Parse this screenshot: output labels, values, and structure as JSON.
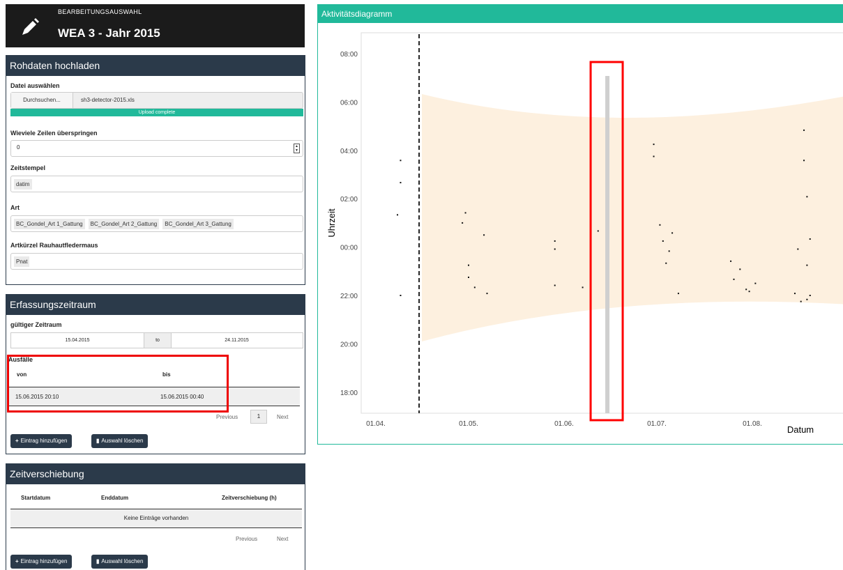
{
  "header": {
    "subtitle": "BEARBEITUNGSAUSWAHL",
    "title": "WEA 3 - Jahr 2015",
    "icon": "pencil-icon"
  },
  "upload": {
    "panel_title": "Rohdaten hochladen",
    "file_label": "Datei auswählen",
    "browse_label": "Durchsuchen...",
    "file_name": "sh3-detector-2015.xls",
    "progress_text": "Upload complete",
    "progress": 1.0,
    "skip_label": "Wieviele Zeilen überspringen",
    "skip_value": "0",
    "timestamp_label": "Zeitstempel",
    "timestamp_value": "datim",
    "species_label": "Art",
    "species_values": [
      "BC_Gondel_Art 1_Gattung",
      "BC_Gondel_Art 2_Gattung",
      "BC_Gondel_Art 3_Gattung"
    ],
    "abbr_label": "Artkürzel Rauhautfledermaus",
    "abbr_value": "Pnat"
  },
  "period": {
    "panel_title": "Erfassungszeitraum",
    "valid_label": "gültiger Zeitraum",
    "start": "15.04.2015",
    "to": "to",
    "end": "24.11.2015",
    "outages_label": "Ausfälle",
    "col_from": "von",
    "col_to": "bis",
    "rows": [
      {
        "from": "15.06.2015 20:10",
        "to": "15.06.2015 00:40"
      }
    ],
    "previous": "Previous",
    "page": "1",
    "next": "Next",
    "add_label": "Eintrag hinzufügen",
    "delete_label": "Auswahl löschen"
  },
  "shift": {
    "panel_title": "Zeitverschiebung",
    "col_start": "Startdatum",
    "col_end": "Enddatum",
    "col_shift": "Zeitverschiebung (h)",
    "empty": "Keine Einträge vorhanden",
    "previous": "Previous",
    "next": "Next",
    "add_label": "Eintrag hinzufügen",
    "delete_label": "Auswahl löschen"
  },
  "chart": {
    "panel_title": "Aktivitätsdiagramm",
    "accent": "#21b99a",
    "highlight": "#ff0000"
  },
  "chart_data": {
    "type": "scatter",
    "xlabel": "Datum",
    "ylabel": "Uhrzeit",
    "x_ticks": [
      "01.04.",
      "01.05.",
      "01.06.",
      "01.07.",
      "01.08."
    ],
    "y_ticks": [
      "08:00",
      "06:00",
      "04:00",
      "02:00",
      "00:00",
      "22:00",
      "20:00",
      "18:00"
    ],
    "period_start": "15.04.",
    "outage": {
      "date": "15.06.",
      "from": "20:10",
      "to": "00:40"
    },
    "night_band_color": "#fdf0df",
    "points": [
      [
        "09.04.",
        "03:35"
      ],
      [
        "09.04.",
        "02:40"
      ],
      [
        "08.04.",
        "01:20"
      ],
      [
        "09.04.",
        "22:00"
      ],
      [
        "30.04.",
        "01:25"
      ],
      [
        "29.04.",
        "01:00"
      ],
      [
        "01.05.",
        "22:45"
      ],
      [
        "03.05.",
        "22:20"
      ],
      [
        "01.05.",
        "23:15"
      ],
      [
        "06.05.",
        "00:30"
      ],
      [
        "07.05.",
        "22:05"
      ],
      [
        "29.05.",
        "23:55"
      ],
      [
        "29.05.",
        "22:25"
      ],
      [
        "29.05.",
        "00:15"
      ],
      [
        "07.06.",
        "22:20"
      ],
      [
        "12.06.",
        "00:40"
      ],
      [
        "30.06.",
        "04:15"
      ],
      [
        "30.06.",
        "03:45"
      ],
      [
        "02.07.",
        "00:55"
      ],
      [
        "04.07.",
        "23:20"
      ],
      [
        "03.07.",
        "00:15"
      ],
      [
        "05.07.",
        "23:50"
      ],
      [
        "06.07.",
        "00:35"
      ],
      [
        "08.07.",
        "22:05"
      ],
      [
        "25.07.",
        "23:25"
      ],
      [
        "26.07.",
        "22:40"
      ],
      [
        "28.07.",
        "23:05"
      ],
      [
        "30.07.",
        "22:15"
      ],
      [
        "31.07.",
        "22:10"
      ],
      [
        "02.08.",
        "22:30"
      ],
      [
        "15.08.",
        "22:05"
      ],
      [
        "16.08.",
        "23:55"
      ],
      [
        "18.08.",
        "03:35"
      ],
      [
        "18.08.",
        "04:50"
      ],
      [
        "19.08.",
        "02:05"
      ],
      [
        "19.08.",
        "23:15"
      ],
      [
        "20.08.",
        "22:00"
      ],
      [
        "19.08.",
        "21:50"
      ],
      [
        "17.08.",
        "21:45"
      ],
      [
        "20.08.",
        "00:20"
      ]
    ]
  }
}
